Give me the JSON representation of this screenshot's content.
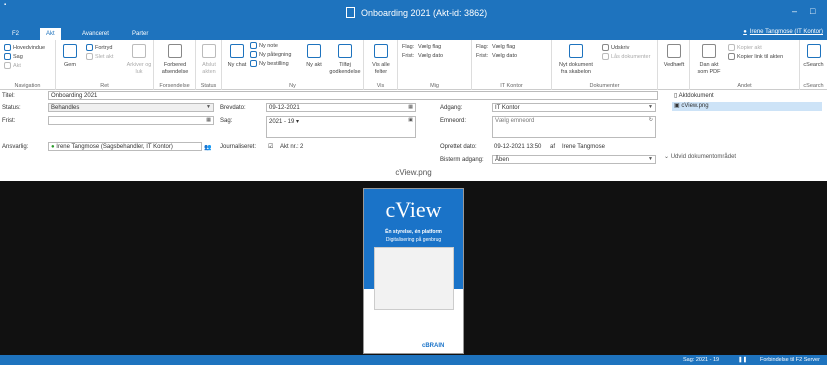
{
  "window": {
    "title": "Onboarding 2021 (Akt-id: 3862)",
    "minimize": "–",
    "restore": "□"
  },
  "tabs": [
    "F2",
    "Akt",
    "Avanceret",
    "Parter"
  ],
  "user": "Irene Tangmose (IT Kontor)",
  "ribbon": {
    "navigation": {
      "label": "Navigation",
      "items": [
        "Hovedvindue",
        "Sag",
        "Akt"
      ]
    },
    "ret": {
      "label": "Ret",
      "gem": "Gem",
      "fortryd": "Fortryd",
      "slet_akt": "Slet akt",
      "arkiver": "Arkiver og luk"
    },
    "forsendelse": {
      "label": "Forsendelse",
      "forbered": "Forbered afsendelse"
    },
    "status": {
      "label": "Status",
      "afslut": "Afslut akten"
    },
    "ny": {
      "label": "Ny",
      "ny_chat": "Ny chat",
      "ny_note": "Ny note",
      "ny_paategning": "Ny påtegning",
      "ny_bestilling": "Ny bestilling",
      "ny_akt": "Ny akt",
      "tilfoej_godkendelse": "Tilføj godkendelse"
    },
    "vis": {
      "label": "Vis",
      "vis_alle_felter": "Vis alle felter"
    },
    "mig": {
      "label": "Mig",
      "flag": "Flag:",
      "frist": "Frist:",
      "vaelg_flag": "Vælg flag",
      "vaelg_dato": "Vælg dato"
    },
    "it_kontor": {
      "label": "IT Kontor",
      "flag": "Flag:",
      "frist": "Frist:",
      "vaelg_flag": "Vælg flag",
      "vaelg_dato": "Vælg dato"
    },
    "dokumenter": {
      "label": "Dokumenter",
      "nyt_dokument": "Nyt dokument fra skabelon",
      "udskriv": "Udskriv",
      "ulaas": "Lås dokumenter"
    },
    "vedhaeft": {
      "label": "Vedhæft"
    },
    "andet": {
      "label": "Andet",
      "dan_akt": "Dan akt som PDF",
      "kopier_akt": "Kopier akt",
      "kopier_link": "Kopier link til akten"
    },
    "csearch": {
      "label": "cSearch",
      "btn": "cSearch"
    }
  },
  "form": {
    "titel_label": "Titel:",
    "titel": "Onboarding 2021",
    "status_label": "Status:",
    "status": "Behandles",
    "frist_label": "Frist:",
    "frist": "",
    "brevdato_label": "Brevdato:",
    "brevdato": "09-12-2021",
    "sag_label": "Sag:",
    "sag": "2021 - 19",
    "adgang_label": "Adgang:",
    "adgang": "IT Kontor",
    "emneord_label": "Emneord:",
    "emneord_placeholder": "Vælg emneord",
    "ansvarlig_label": "Ansvarlig:",
    "ansvarlig": "Irene Tangmose (Sagsbehandler, IT Kontor)",
    "journaliseret_label": "Journaliseret:",
    "akt_nr_label": "Akt nr.:",
    "akt_nr": "2",
    "oprettet_label": "Oprettet dato:",
    "oprettet": "09-12-2021 13:50",
    "af": "af",
    "oprettet_af": "Irene Tangmose",
    "bisterm_label": "Bisterm adgang:",
    "bisterm": "Åben"
  },
  "documents": {
    "aktdokument": "Aktdokument",
    "file": "cView.png",
    "udvid": "Udvid dokumentområdet"
  },
  "viewer": {
    "filename": "cView.png",
    "pdf_title": "cView",
    "pdf_sub1": "Én styrelse, én platform",
    "pdf_sub2": "Digitalisering på genbrug",
    "pdf_brand": "cBRAIN"
  },
  "statusbar": {
    "sag": "Sag: 2021 - 19",
    "server": "Forbindelse til F2 Server"
  }
}
